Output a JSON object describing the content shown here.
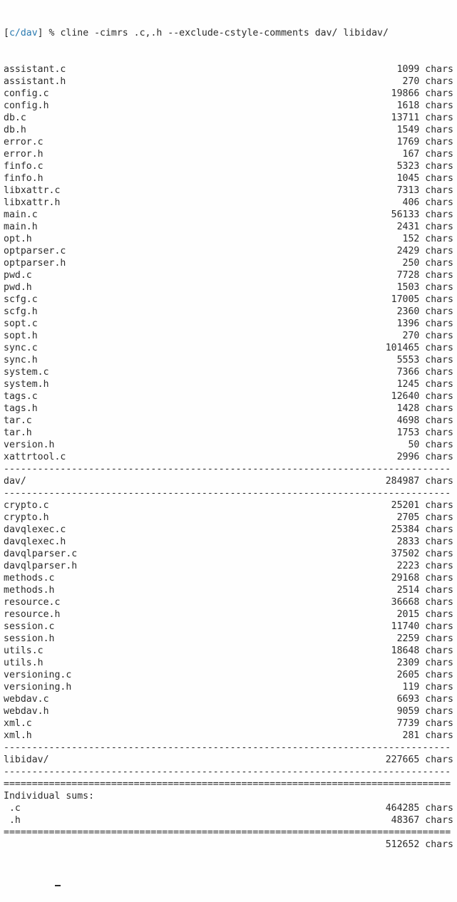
{
  "prompt": {
    "bracket_open": "[",
    "path": "c/dav",
    "bracket_close": "]",
    "sep": " % ",
    "command": "cline -cimrs .c,.h --exclude-cstyle-comments dav/ libidav/"
  },
  "unit": "chars",
  "sections": [
    {
      "files": [
        {
          "name": "assistant.c",
          "chars": 1099
        },
        {
          "name": "assistant.h",
          "chars": 270
        },
        {
          "name": "config.c",
          "chars": 19866
        },
        {
          "name": "config.h",
          "chars": 1618
        },
        {
          "name": "db.c",
          "chars": 13711
        },
        {
          "name": "db.h",
          "chars": 1549
        },
        {
          "name": "error.c",
          "chars": 1769
        },
        {
          "name": "error.h",
          "chars": 167
        },
        {
          "name": "finfo.c",
          "chars": 5323
        },
        {
          "name": "finfo.h",
          "chars": 1045
        },
        {
          "name": "libxattr.c",
          "chars": 7313
        },
        {
          "name": "libxattr.h",
          "chars": 406
        },
        {
          "name": "main.c",
          "chars": 56133
        },
        {
          "name": "main.h",
          "chars": 2431
        },
        {
          "name": "opt.h",
          "chars": 152
        },
        {
          "name": "optparser.c",
          "chars": 2429
        },
        {
          "name": "optparser.h",
          "chars": 250
        },
        {
          "name": "pwd.c",
          "chars": 7728
        },
        {
          "name": "pwd.h",
          "chars": 1503
        },
        {
          "name": "scfg.c",
          "chars": 17005
        },
        {
          "name": "scfg.h",
          "chars": 2360
        },
        {
          "name": "sopt.c",
          "chars": 1396
        },
        {
          "name": "sopt.h",
          "chars": 270
        },
        {
          "name": "sync.c",
          "chars": 101465
        },
        {
          "name": "sync.h",
          "chars": 5553
        },
        {
          "name": "system.c",
          "chars": 7366
        },
        {
          "name": "system.h",
          "chars": 1245
        },
        {
          "name": "tags.c",
          "chars": 12640
        },
        {
          "name": "tags.h",
          "chars": 1428
        },
        {
          "name": "tar.c",
          "chars": 4698
        },
        {
          "name": "tar.h",
          "chars": 1753
        },
        {
          "name": "version.h",
          "chars": 50
        },
        {
          "name": "xattrtool.c",
          "chars": 2996
        }
      ],
      "subtotal": {
        "name": "dav/",
        "chars": 284987
      }
    },
    {
      "files": [
        {
          "name": "crypto.c",
          "chars": 25201
        },
        {
          "name": "crypto.h",
          "chars": 2705
        },
        {
          "name": "davqlexec.c",
          "chars": 25384
        },
        {
          "name": "davqlexec.h",
          "chars": 2833
        },
        {
          "name": "davqlparser.c",
          "chars": 37502
        },
        {
          "name": "davqlparser.h",
          "chars": 2223
        },
        {
          "name": "methods.c",
          "chars": 29168
        },
        {
          "name": "methods.h",
          "chars": 2514
        },
        {
          "name": "resource.c",
          "chars": 36668
        },
        {
          "name": "resource.h",
          "chars": 2015
        },
        {
          "name": "session.c",
          "chars": 11740
        },
        {
          "name": "session.h",
          "chars": 2259
        },
        {
          "name": "utils.c",
          "chars": 18648
        },
        {
          "name": "utils.h",
          "chars": 2309
        },
        {
          "name": "versioning.c",
          "chars": 2605
        },
        {
          "name": "versioning.h",
          "chars": 119
        },
        {
          "name": "webdav.c",
          "chars": 6693
        },
        {
          "name": "webdav.h",
          "chars": 9059
        },
        {
          "name": "xml.c",
          "chars": 7739
        },
        {
          "name": "xml.h",
          "chars": 281
        }
      ],
      "subtotal": {
        "name": "libidav/",
        "chars": 227665
      }
    }
  ],
  "sums_header": "Individual sums:",
  "sums": [
    {
      "name": " .c",
      "chars": 464285
    },
    {
      "name": " .h",
      "chars": 48367
    }
  ],
  "grand_total": 512652,
  "dash_line": "-------------------------------------------------------------------------------",
  "eq_line": "==============================================================================="
}
